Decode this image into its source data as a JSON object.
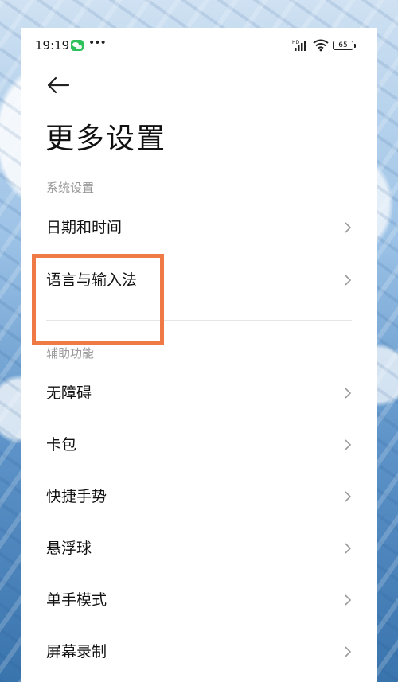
{
  "status_bar": {
    "time": "19:19",
    "notification_icons": [
      "wechat-icon",
      "more-icon"
    ],
    "battery_level": "65",
    "network_label": "HD"
  },
  "header": {
    "back_icon": "arrow-left-icon",
    "title": "更多设置"
  },
  "sections": [
    {
      "header": "系统设置",
      "items": [
        {
          "label": "日期和时间"
        },
        {
          "label": "语言与输入法"
        }
      ]
    },
    {
      "header": "辅助功能",
      "items": [
        {
          "label": "无障碍"
        },
        {
          "label": "卡包"
        },
        {
          "label": "快捷手势"
        },
        {
          "label": "悬浮球"
        },
        {
          "label": "单手模式"
        },
        {
          "label": "屏幕录制"
        }
      ]
    }
  ],
  "colors": {
    "highlight": "#ef7a46",
    "wechat": "#2dc15a",
    "section_header": "#9a9a9a"
  }
}
